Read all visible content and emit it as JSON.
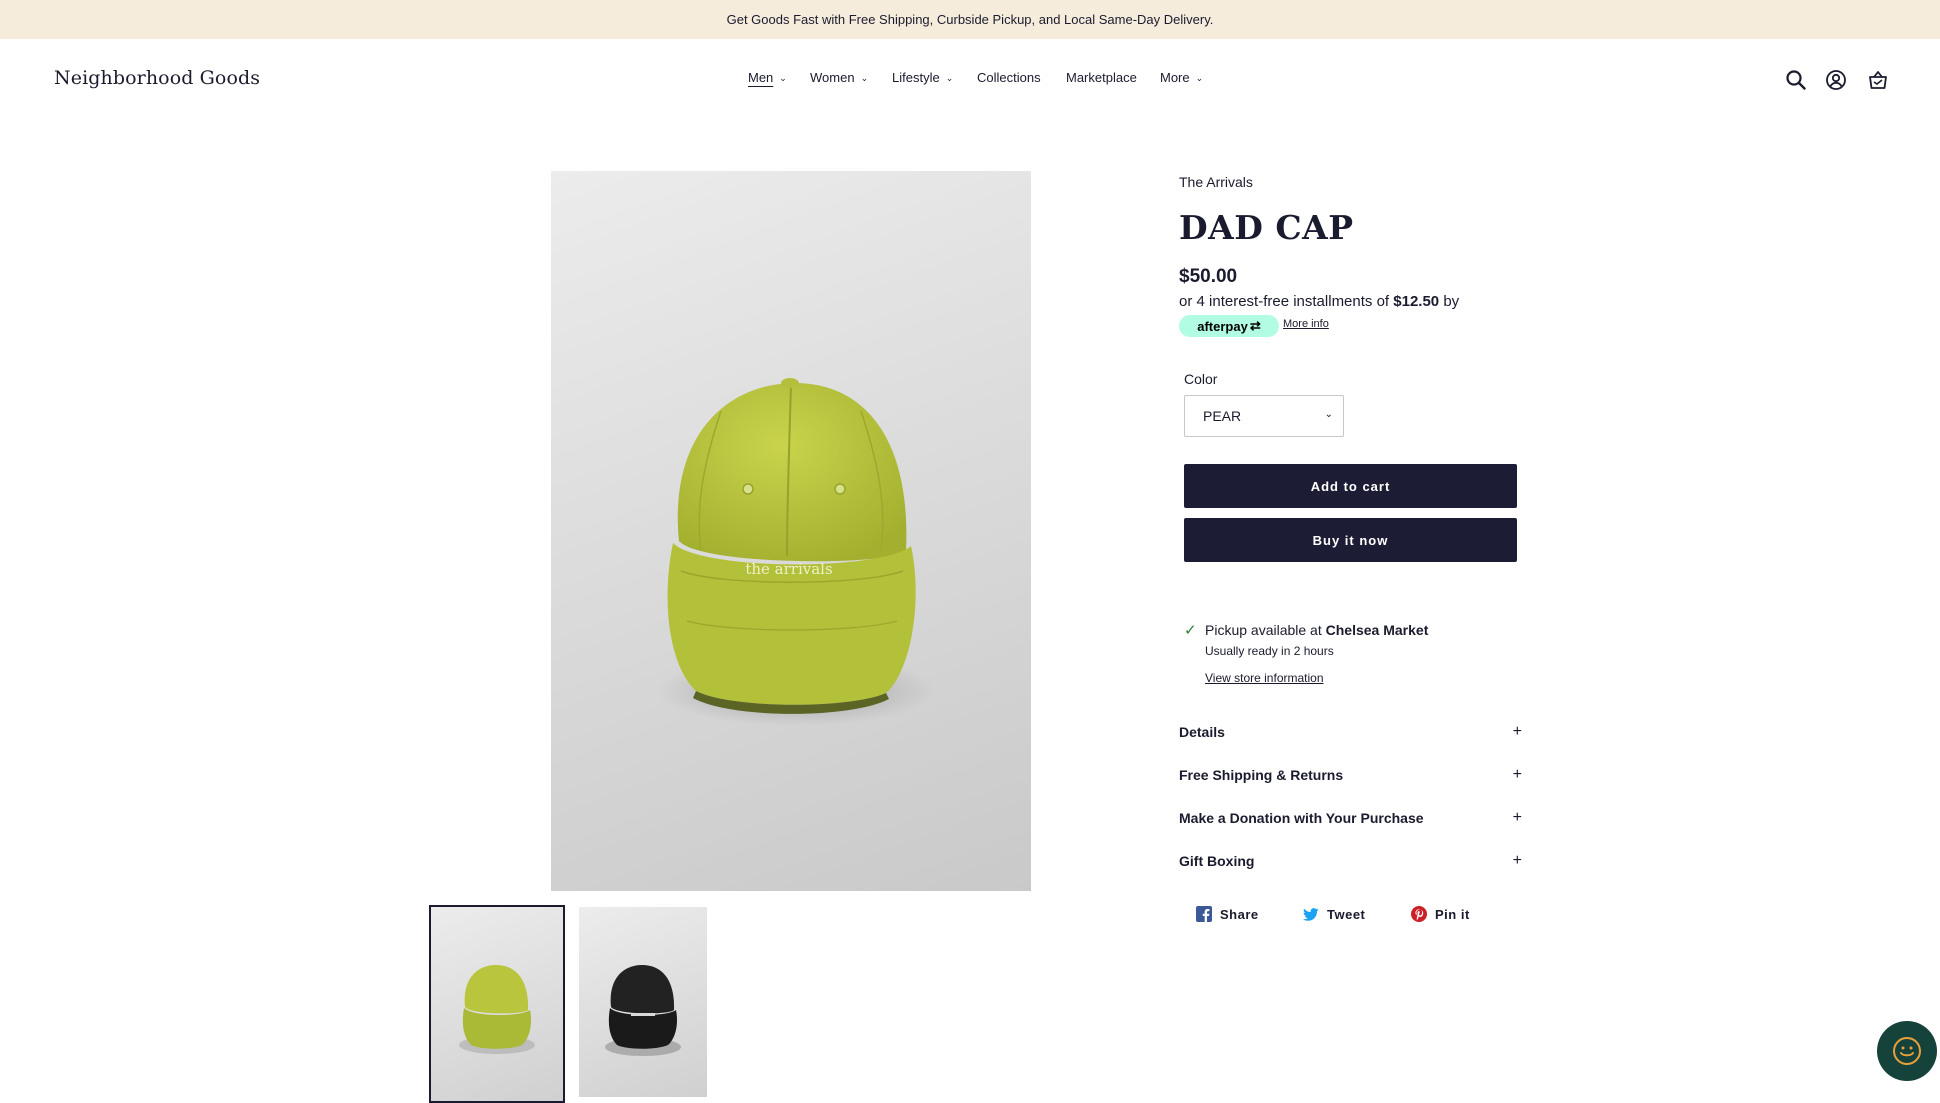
{
  "announcement": "Get Goods Fast with Free Shipping, Curbside Pickup, and Local Same-Day Delivery.",
  "brand": "Neighborhood Goods",
  "nav": {
    "items": [
      {
        "label": "Men",
        "has_dropdown": true,
        "active": true
      },
      {
        "label": "Women",
        "has_dropdown": true
      },
      {
        "label": "Lifestyle",
        "has_dropdown": true
      },
      {
        "label": "Collections",
        "has_dropdown": false
      },
      {
        "label": "Marketplace",
        "has_dropdown": false
      },
      {
        "label": "More",
        "has_dropdown": true
      }
    ]
  },
  "header_icons": [
    "search-icon",
    "account-icon",
    "cart-icon"
  ],
  "product": {
    "vendor": "The Arrivals",
    "title": "DAD CAP",
    "price": "$50.00",
    "installments_prefix": "or 4 interest-free installments of",
    "installment_amount": "$12.50",
    "installments_suffix": "by",
    "afterpay_logo": "afterpay",
    "more_info": "More info",
    "color_label": "Color",
    "color_selected": "PEAR",
    "add_to_cart": "Add to cart",
    "buy_now": "Buy it now",
    "cap_text": "the arrivals",
    "main_cap_color": "#b8c53d",
    "thumb_colors": [
      "#b8c53d",
      "#1e1e1e"
    ]
  },
  "pickup": {
    "prefix": "Pickup available at",
    "location": "Chelsea Market",
    "ready": "Usually ready in 2 hours",
    "store_link": "View store information"
  },
  "accordions": [
    "Details",
    "Free Shipping & Returns",
    "Make a Donation with Your Purchase",
    "Gift Boxing"
  ],
  "accordion_icon": "+",
  "social": {
    "share": "Share",
    "tweet": "Tweet",
    "pin": "Pin it"
  },
  "colors": {
    "announcement_bg": "#f6ecdc",
    "primary_button": "#1c1d35",
    "afterpay_mint": "#b2fce4",
    "chat_bubble": "#15423a"
  }
}
